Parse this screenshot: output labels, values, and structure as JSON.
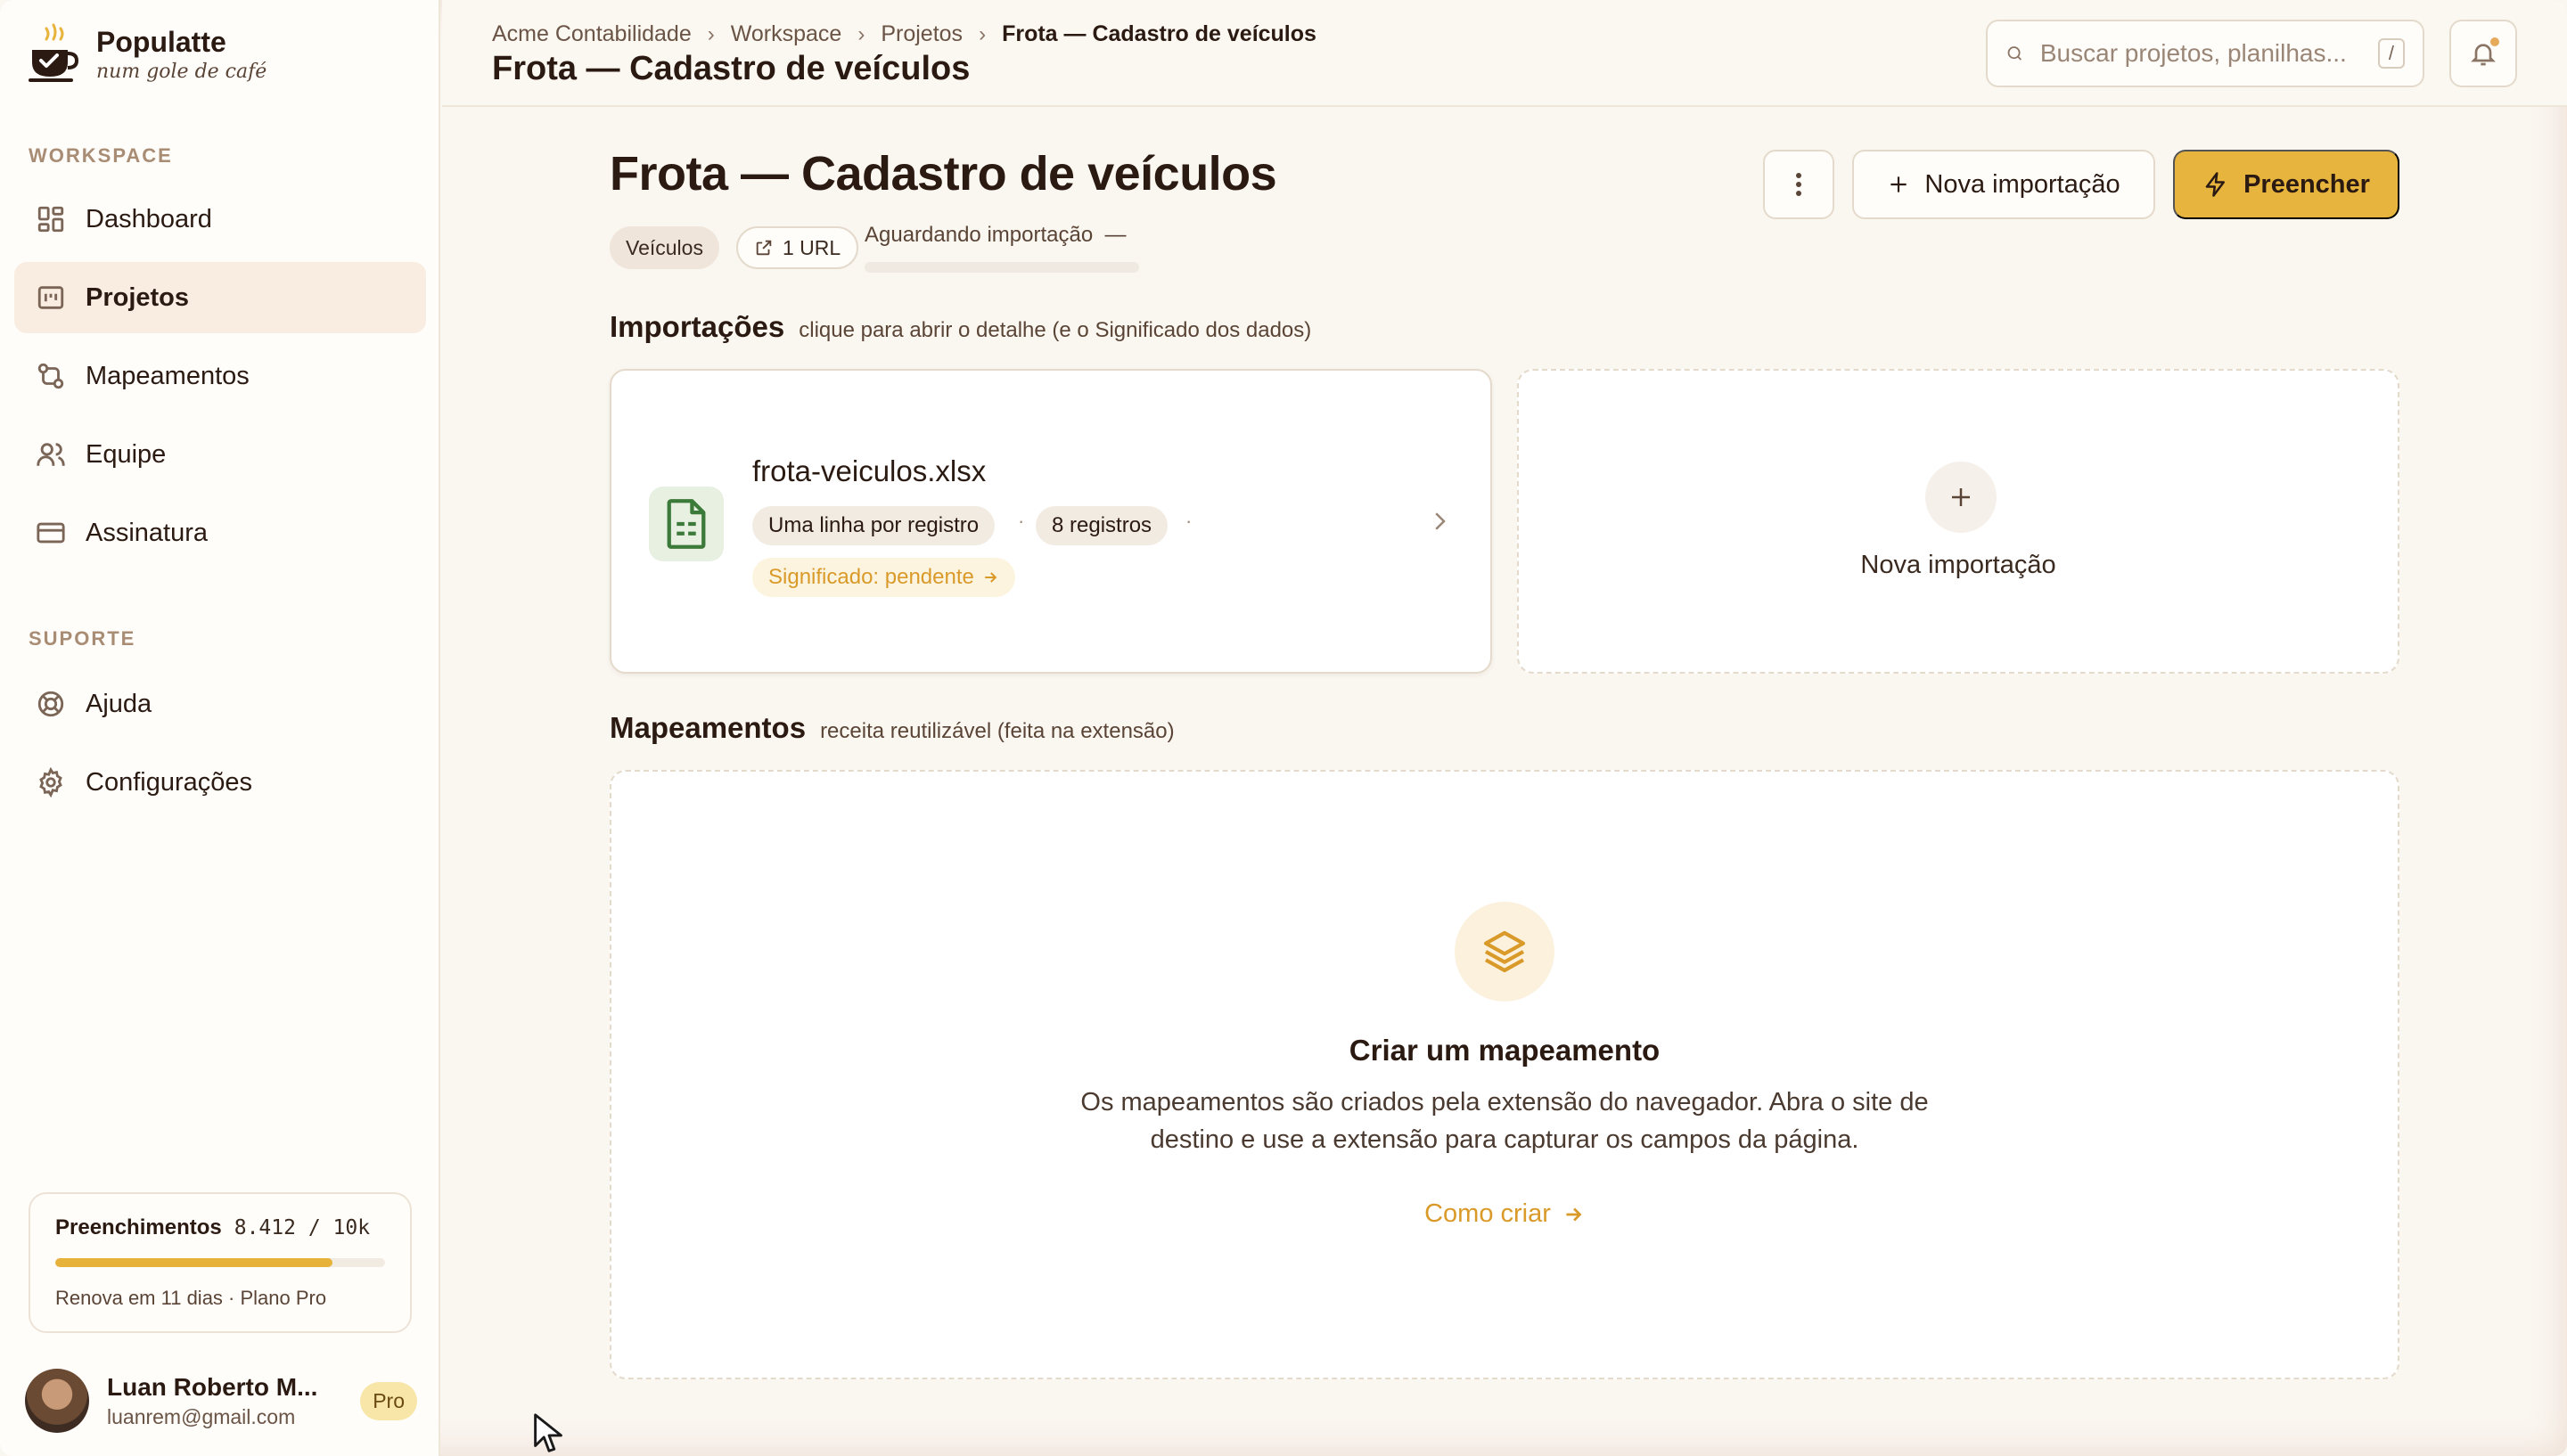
{
  "brand": {
    "name": "Populatte",
    "tagline": "num gole de café"
  },
  "sidebar": {
    "workspace_label": "WORKSPACE",
    "items": [
      {
        "label": "Dashboard",
        "icon": "dashboard-icon"
      },
      {
        "label": "Projetos",
        "icon": "projects-icon"
      },
      {
        "label": "Mapeamentos",
        "icon": "mappings-icon"
      },
      {
        "label": "Equipe",
        "icon": "team-icon"
      },
      {
        "label": "Assinatura",
        "icon": "card-icon"
      }
    ],
    "support_label": "SUPORTE",
    "support_items": [
      {
        "label": "Ajuda",
        "icon": "lifebuoy-icon"
      },
      {
        "label": "Configurações",
        "icon": "gear-icon"
      }
    ],
    "active": "Projetos"
  },
  "usage": {
    "title": "Preenchimentos",
    "count": "8.412 / 10k",
    "fraction": 0.8412,
    "note": "Renova em 11 dias · Plano Pro"
  },
  "user": {
    "name": "Luan Roberto M...",
    "email": "luanrem@gmail.com",
    "plan": "Pro"
  },
  "header": {
    "breadcrumb": [
      "Acme Contabilidade",
      "Workspace",
      "Projetos",
      "Frota — Cadastro de veículos"
    ],
    "title": "Frota — Cadastro de veículos",
    "search_placeholder": "Buscar projetos, planilhas...",
    "search_shortcut": "/"
  },
  "project": {
    "title": "Frota — Cadastro de veículos",
    "tag": "Veículos",
    "url_count": "1 URL",
    "status": "Aguardando importação",
    "status_value": "—",
    "actions": {
      "new_import": "Nova importação",
      "fill": "Preencher"
    }
  },
  "imports": {
    "title": "Importações",
    "subtitle": "clique para abrir o detalhe (e o Significado dos dados)",
    "file": {
      "name": "frota-veiculos.xlsx",
      "mode": "Uma linha por registro",
      "records": "8 registros",
      "meaning": "Significado: pendente"
    },
    "new_label": "Nova importação"
  },
  "mappings": {
    "title": "Mapeamentos",
    "subtitle": "receita reutilizável (feita na extensão)",
    "empty_title": "Criar um mapeamento",
    "empty_desc": "Os mapeamentos são criados pela extensão do navegador. Abra o site de destino e use a extensão para capturar os campos da página.",
    "link": "Como criar"
  },
  "colors": {
    "accent": "#e7b43e",
    "accent_text": "#d99a2a",
    "sheet_green": "#3c7a3a"
  }
}
